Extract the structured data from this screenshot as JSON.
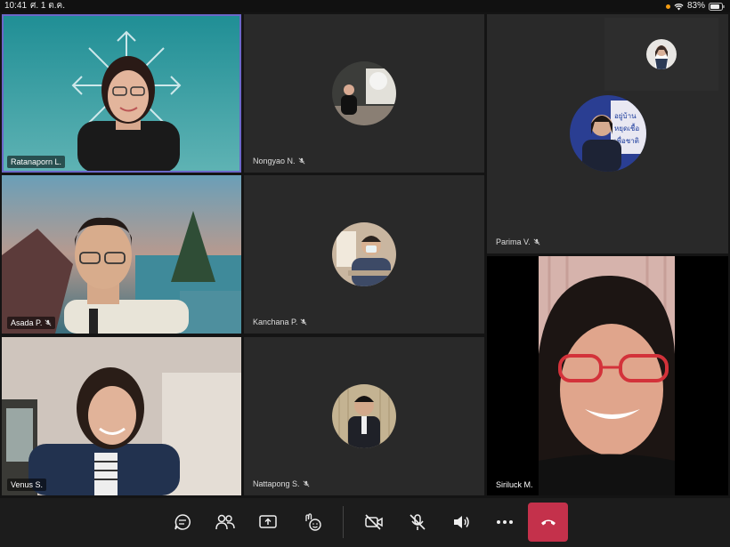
{
  "status": {
    "time": "10:41",
    "date": "ศ. 1 ต.ค.",
    "battery": "83%",
    "battery_level": 0.83
  },
  "participants": [
    {
      "name": "Ratanaporn L.",
      "type": "video",
      "muted": false
    },
    {
      "name": "Nongyao N.",
      "type": "avatar",
      "muted": true
    },
    {
      "name": "Parima V.",
      "type": "avatar",
      "muted": true
    },
    {
      "name": "Asada P.",
      "type": "video",
      "muted": true
    },
    {
      "name": "Kanchana P.",
      "type": "avatar",
      "muted": true
    },
    {
      "name": "Venus S.",
      "type": "video",
      "muted": false
    },
    {
      "name": "Nattapong S.",
      "type": "avatar",
      "muted": true
    },
    {
      "name": "Siriluck M.",
      "type": "video",
      "muted": false
    }
  ],
  "toolbar": {
    "buttons": [
      "chat-icon",
      "participants-icon",
      "share-icon",
      "reactions-icon",
      "camera-off-icon",
      "mic-off-icon",
      "speaker-icon",
      "more-icon",
      "hang-up-icon"
    ]
  },
  "colors": {
    "accent": "#6b68c9",
    "hangup": "#c4314b",
    "tile": "#292929"
  }
}
